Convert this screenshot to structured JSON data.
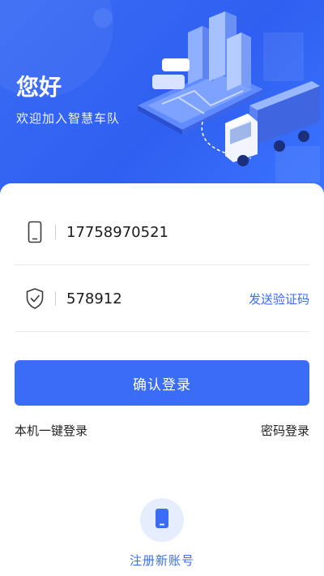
{
  "header": {
    "greeting": "您好",
    "subtitle": "欢迎加入智慧车队"
  },
  "form": {
    "phone_value": "17758970521",
    "code_value": "578912",
    "send_code_label": "发送验证码"
  },
  "actions": {
    "login_label": "确认登录",
    "one_click_login_label": "本机一键登录",
    "password_login_label": "密码登录",
    "register_label": "注册新账号"
  },
  "colors": {
    "accent": "#3a6cf5",
    "header_bg": "#2f5ff0",
    "register_circle_bg": "#e6edfd"
  },
  "icons": {
    "phone_field": "mobile-phone-icon",
    "code_field": "shield-check-icon",
    "register": "mobile-device-icon"
  }
}
